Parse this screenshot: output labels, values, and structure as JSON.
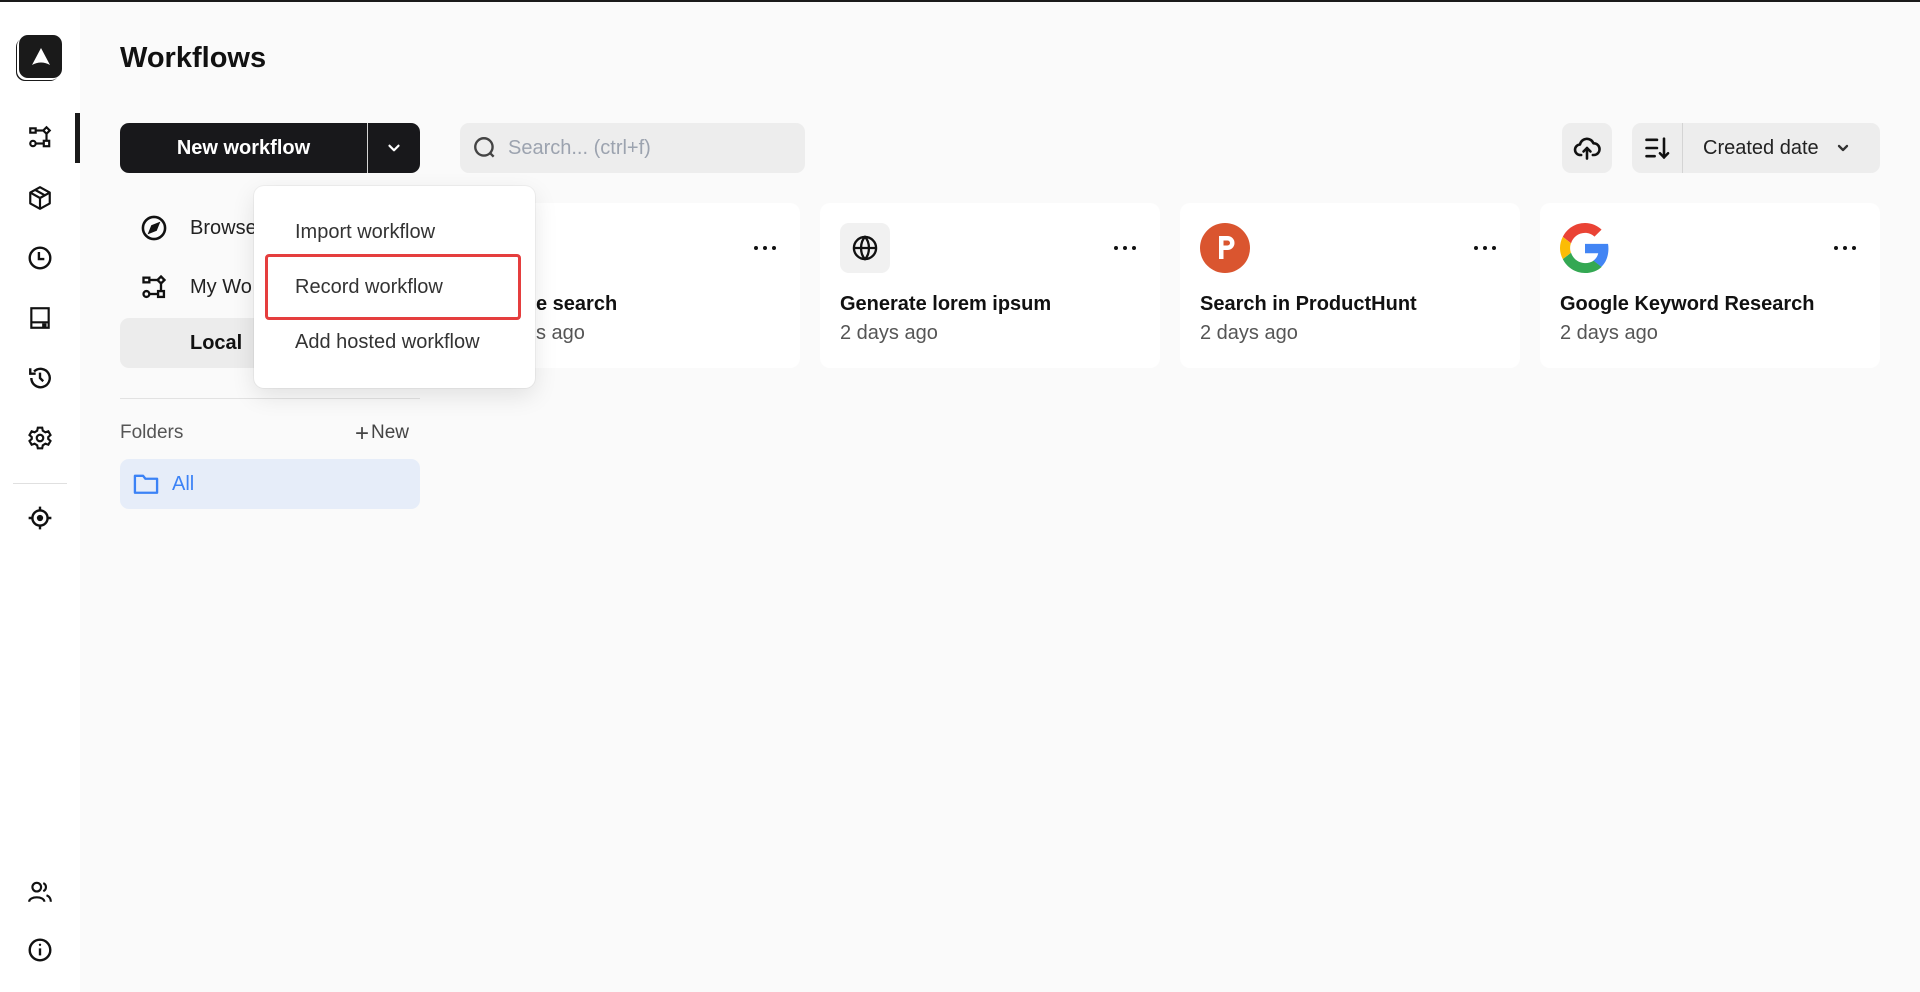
{
  "app": {
    "title": "Workflows",
    "accent_color": "#18181b",
    "highlight_color": "#e53e3e"
  },
  "rail": {
    "logo": "automa-logo-icon",
    "items": [
      {
        "name": "workflows",
        "icon": "workflow-icon",
        "active": true
      },
      {
        "name": "packages",
        "icon": "package-icon"
      },
      {
        "name": "schedule",
        "icon": "clock-icon"
      },
      {
        "name": "storage",
        "icon": "storage-icon"
      },
      {
        "name": "logs",
        "icon": "history-icon"
      },
      {
        "name": "settings",
        "icon": "gear-icon"
      },
      {
        "name": "element-picker",
        "icon": "crosshair-icon"
      }
    ],
    "bottom_items": [
      {
        "name": "community",
        "icon": "users-icon"
      },
      {
        "name": "about",
        "icon": "info-icon"
      }
    ]
  },
  "toolbar": {
    "new_workflow_label": "New workflow",
    "search_placeholder": "Search... (ctrl+f)",
    "search_value": "",
    "sort_selected": "Created date"
  },
  "nav": {
    "browse_label": "Browse",
    "my_workflows_label": "My Wo",
    "local_label": "Local"
  },
  "folders": {
    "label": "Folders",
    "new_label": "New",
    "items": [
      {
        "label": "All",
        "active": true
      }
    ]
  },
  "menu": {
    "items": [
      {
        "label": "Import workflow"
      },
      {
        "label": "Record workflow",
        "highlighted": true
      },
      {
        "label": "Add hosted workflow"
      }
    ]
  },
  "cards": [
    {
      "title": "e search",
      "time": "s ago",
      "icon": "none",
      "partially_hidden": true
    },
    {
      "title": "Generate lorem ipsum",
      "time": "2 days ago",
      "icon": "globe-icon"
    },
    {
      "title": "Search in ProductHunt",
      "time": "2 days ago",
      "icon": "producthunt-icon",
      "icon_color": "#da552f"
    },
    {
      "title": "Google Keyword Research",
      "time": "2 days ago",
      "icon": "google-icon"
    }
  ]
}
